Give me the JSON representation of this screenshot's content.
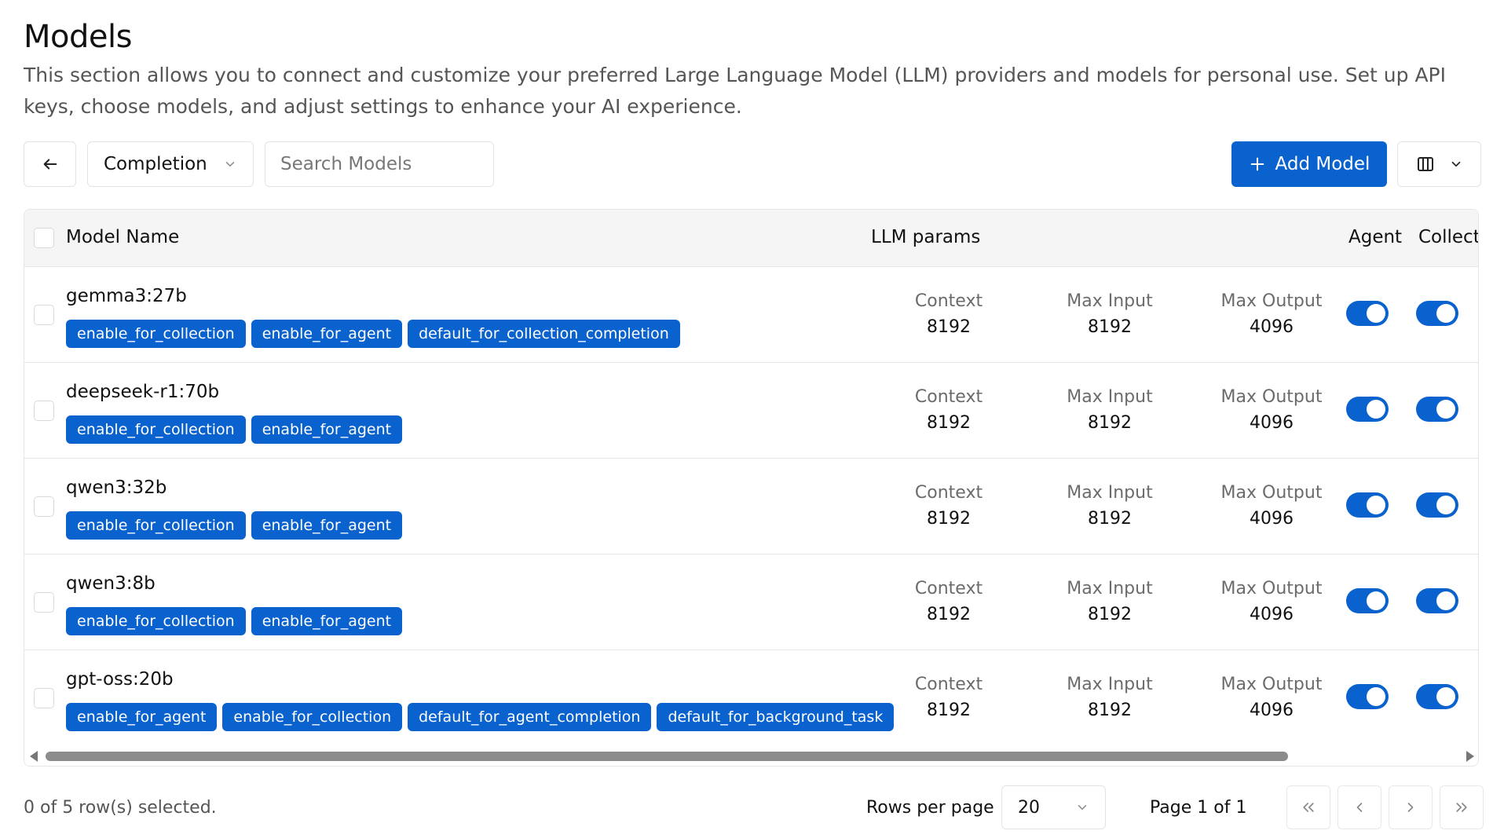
{
  "header": {
    "title": "Models",
    "description": "This section allows you to connect and customize your preferred Large Language Model (LLM) providers and models for personal use. Set up API keys, choose models, and adjust settings to enhance your AI experience."
  },
  "toolbar": {
    "type_select_value": "Completion",
    "search_placeholder": "Search Models",
    "add_label": "Add Model"
  },
  "table": {
    "columns": {
      "model_name": "Model Name",
      "llm_params": "LLM params",
      "agent": "Agent",
      "collection": "Collectic"
    },
    "rows": [
      {
        "name": "gemma3:27b",
        "tags": [
          "enable_for_collection",
          "enable_for_agent",
          "default_for_collection_completion"
        ],
        "context_label": "Context",
        "context": "8192",
        "max_input_label": "Max Input",
        "max_input": "8192",
        "max_output_label": "Max Output",
        "max_output": "4096",
        "agent_enabled": true,
        "collection_enabled": true
      },
      {
        "name": "deepseek-r1:70b",
        "tags": [
          "enable_for_collection",
          "enable_for_agent"
        ],
        "context_label": "Context",
        "context": "8192",
        "max_input_label": "Max Input",
        "max_input": "8192",
        "max_output_label": "Max Output",
        "max_output": "4096",
        "agent_enabled": true,
        "collection_enabled": true
      },
      {
        "name": "qwen3:32b",
        "tags": [
          "enable_for_collection",
          "enable_for_agent"
        ],
        "context_label": "Context",
        "context": "8192",
        "max_input_label": "Max Input",
        "max_input": "8192",
        "max_output_label": "Max Output",
        "max_output": "4096",
        "agent_enabled": true,
        "collection_enabled": true
      },
      {
        "name": "qwen3:8b",
        "tags": [
          "enable_for_collection",
          "enable_for_agent"
        ],
        "context_label": "Context",
        "context": "8192",
        "max_input_label": "Max Input",
        "max_input": "8192",
        "max_output_label": "Max Output",
        "max_output": "4096",
        "agent_enabled": true,
        "collection_enabled": true
      },
      {
        "name": "gpt-oss:20b",
        "tags": [
          "enable_for_agent",
          "enable_for_collection",
          "default_for_agent_completion",
          "default_for_background_task"
        ],
        "context_label": "Context",
        "context": "8192",
        "max_input_label": "Max Input",
        "max_input": "8192",
        "max_output_label": "Max Output",
        "max_output": "4096",
        "agent_enabled": true,
        "collection_enabled": true
      }
    ]
  },
  "footer": {
    "selection": "0 of 5 row(s) selected.",
    "rows_per_page_label": "Rows per page",
    "rows_per_page_value": "20",
    "page_info": "Page 1 of 1"
  },
  "colors": {
    "accent": "#0a62cf",
    "header_bg": "#f5f5f5",
    "border": "#e6e6e6"
  }
}
